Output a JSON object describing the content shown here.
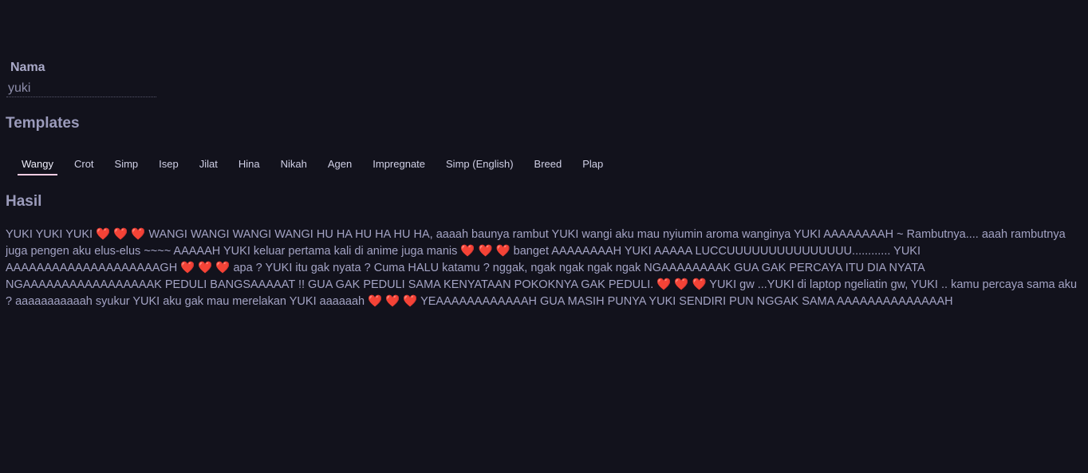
{
  "form": {
    "name_label": "Nama",
    "name_value": "yuki"
  },
  "templates": {
    "title": "Templates",
    "tabs": [
      "Wangy",
      "Crot",
      "Simp",
      "Isep",
      "Jilat",
      "Hina",
      "Nikah",
      "Agen",
      "Impregnate",
      "Simp (English)",
      "Breed",
      "Plap"
    ],
    "active": "Wangy"
  },
  "result": {
    "title": "Hasil",
    "text": "YUKI YUKI YUKI ❤️ ❤️ ❤️ WANGI WANGI WANGI WANGI HU HA HU HA HU HA, aaaah baunya rambut YUKI wangi aku mau nyiumin aroma wanginya YUKI AAAAAAAAH ~ Rambutnya.... aaah rambutnya juga pengen aku elus-elus ~~~~ AAAAAH YUKI keluar pertama kali di anime juga manis ❤️ ❤️ ❤️ banget AAAAAAAAH YUKI AAAAA LUCCUUUUUUUUUUUUUUU............ YUKI AAAAAAAAAAAAAAAAAAAAGH ❤️ ❤️ ❤️ apa ? YUKI itu gak nyata ? Cuma HALU katamu ? nggak, ngak ngak ngak ngak NGAAAAAAAAK GUA GAK PERCAYA ITU DIA NYATA NGAAAAAAAAAAAAAAAAAK PEDULI BANGSAAAAAT !! GUA GAK PEDULI SAMA KENYATAAN POKOKNYA GAK PEDULI. ❤️ ❤️ ❤️ YUKI gw ...YUKI di laptop ngeliatin gw, YUKI .. kamu percaya sama aku ? aaaaaaaaaaah syukur YUKI aku gak mau merelakan YUKI aaaaaah ❤️ ❤️ ❤️ YEAAAAAAAAAAAAH GUA MASIH PUNYA YUKI SENDIRI PUN NGGAK SAMA AAAAAAAAAAAAAAH"
  }
}
